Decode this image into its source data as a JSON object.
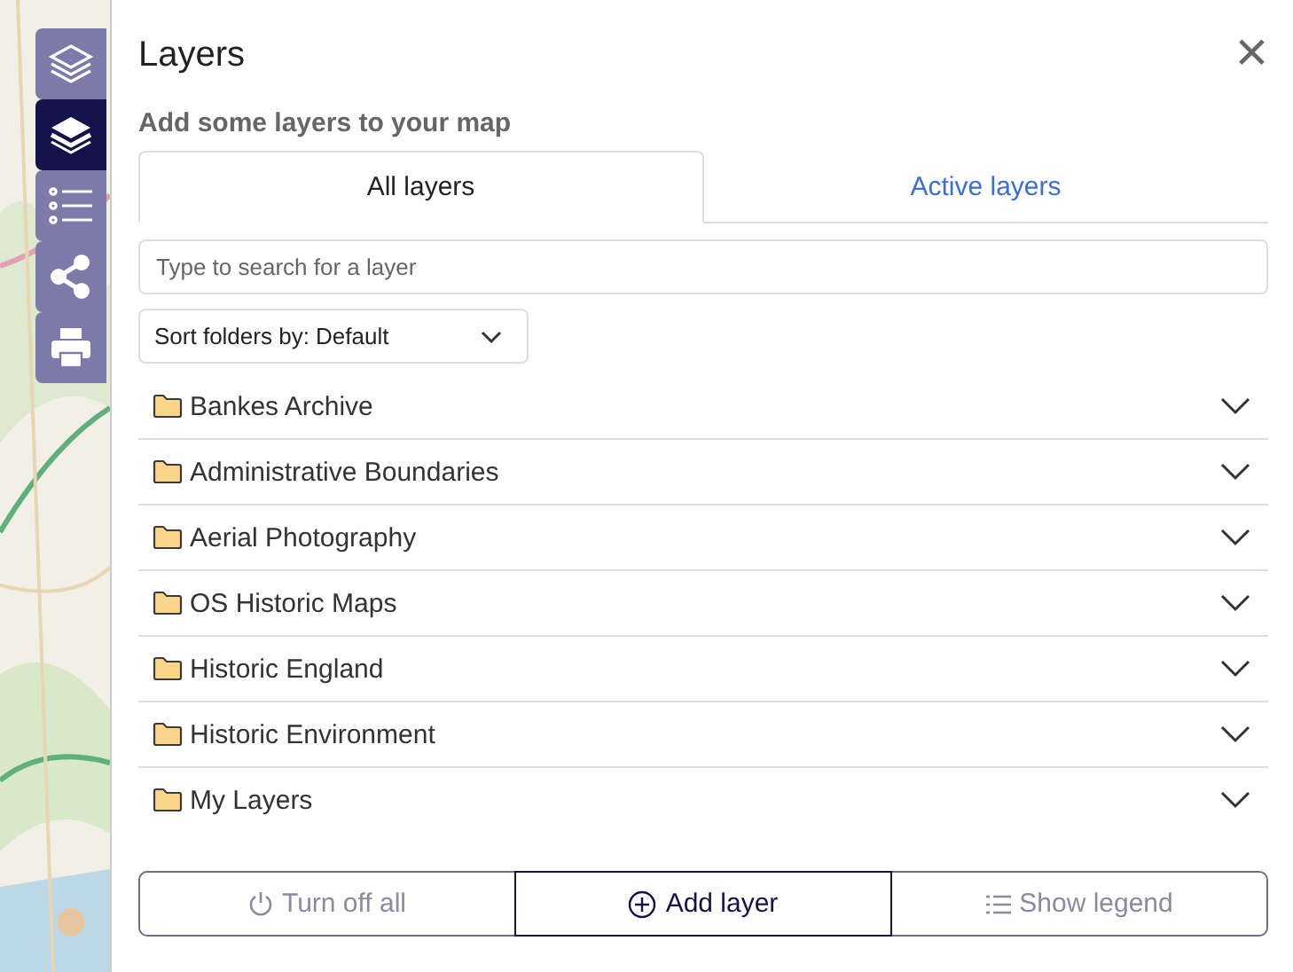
{
  "toolbar": [
    {
      "kind": "layers-outline",
      "selected": false
    },
    {
      "kind": "layers",
      "selected": true
    },
    {
      "kind": "list",
      "selected": false
    },
    {
      "kind": "share",
      "selected": false
    },
    {
      "kind": "print",
      "selected": false
    }
  ],
  "panel": {
    "title": "Layers",
    "close": "×",
    "subtitle": "Add some layers to your map",
    "tabs": [
      {
        "label": "All layers",
        "selected": true
      },
      {
        "label": "Active layers",
        "selected": false
      }
    ],
    "search": {
      "placeholder": "Type to search for a layer"
    },
    "sort": {
      "value": "Sort folders by: Default"
    },
    "folders": [
      {
        "name": "Bankes Archive",
        "expanded": false
      },
      {
        "name": "Administrative Boundaries",
        "expanded": false
      },
      {
        "name": "Aerial Photography",
        "expanded": false
      },
      {
        "name": "OS Historic Maps",
        "expanded": false
      },
      {
        "name": "Historic England",
        "expanded": false
      },
      {
        "name": "Historic Environment",
        "expanded": false
      },
      {
        "name": "My Layers",
        "expanded": false
      }
    ],
    "footer": [
      {
        "kind": "power",
        "label": "Turn off all",
        "disabled": true
      },
      {
        "kind": "add",
        "label": "Add layer",
        "disabled": false
      },
      {
        "kind": "legend",
        "label": "Show legend",
        "disabled": true
      }
    ]
  }
}
